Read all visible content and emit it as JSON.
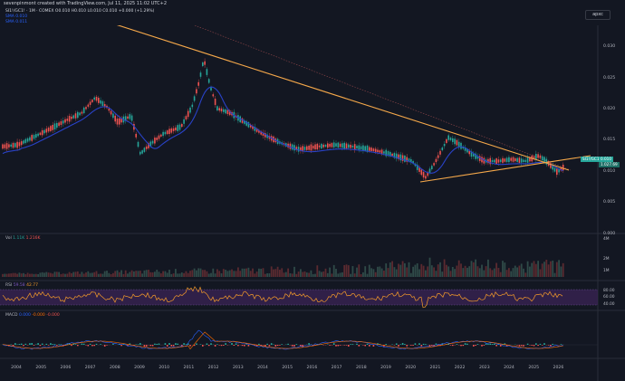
{
  "header": {
    "credit": "sevenpinmont created with TradingView.com, Jul 11, 2025 11:02 UTC+2",
    "ticker_line": "SI1!/GC1! · 1M · COMEX  O0.010 H0.010 L0.010 C0.010 +0.000 (+1.29%)",
    "sma1": "SMA  0.010",
    "sma2": "SMA  0.011",
    "ticker_color": "#d1d4dc",
    "up_color": "#26a69a",
    "down_color": "#ef5350"
  },
  "top_right": {
    "label": "apxc"
  },
  "price_axis": {
    "labels": [
      "0.030",
      "0.025",
      "0.020",
      "0.015",
      "0.010",
      "0.005",
      "0.000"
    ],
    "current_price_badge": "0.010",
    "current_symbol_badge": "SI1!/GC1!",
    "current_sub_badge": "1.027.69"
  },
  "volume_pane": {
    "legend_name": "Vol",
    "legend_v1": "1.11K",
    "legend_v2": "1.216K",
    "axis_labels": [
      "4M",
      "2M",
      "1M"
    ]
  },
  "rsi_pane": {
    "legend_name": "RSI",
    "legend_v1": "59.58",
    "legend_v2": "42.77",
    "axis_labels": [
      "80.00",
      "60.00",
      "40.00"
    ]
  },
  "macd_pane": {
    "legend_name": "MACD",
    "legend_v1": "0.000",
    "legend_v2": "-0.000",
    "legend_v3": "-0.000"
  },
  "x_axis": {
    "labels": [
      "2004",
      "2005",
      "2006",
      "2007",
      "2008",
      "2009",
      "2010",
      "2011",
      "2012",
      "2013",
      "2014",
      "2015",
      "2016",
      "2017",
      "2018",
      "2019",
      "2020",
      "2021",
      "2022",
      "2023",
      "2024",
      "2025",
      "2026"
    ]
  },
  "colors": {
    "background": "#131722",
    "trendline": "#f5a84a",
    "sma_line": "#2942c7",
    "volume_bar": "#4a2a2e",
    "rsi_band": "#3b2456",
    "rsi_line": "#f59b2a",
    "macd_line": "#2962ff",
    "signal_line": "#ff6d00"
  }
}
